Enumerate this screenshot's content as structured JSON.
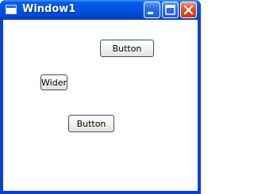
{
  "window": {
    "title": "Window1",
    "controls": {
      "minimize": "minimize-icon",
      "maximize": "maximize-icon",
      "close": "close-icon"
    }
  },
  "buttons": [
    {
      "label": "Button"
    },
    {
      "label": "Wider"
    },
    {
      "label": "Button"
    }
  ],
  "colors": {
    "titlebar": "#0054e3",
    "frame": "#0a3fd6",
    "close": "#e0552c",
    "button_border": "#2f4f7f"
  }
}
